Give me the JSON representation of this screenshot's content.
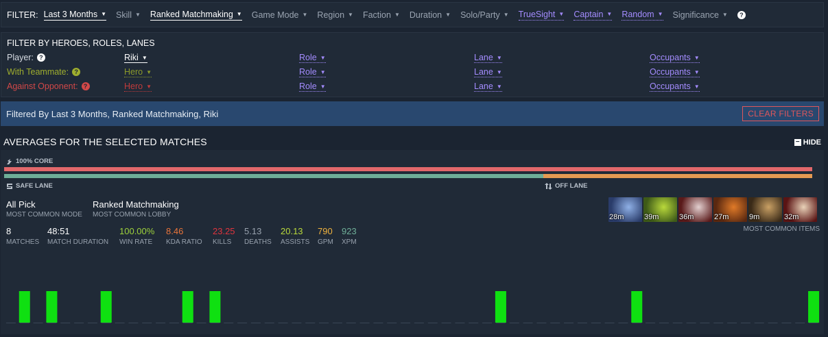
{
  "filterbar": {
    "label": "FILTER:",
    "items": [
      {
        "label": "Last 3 Months",
        "style": "sel"
      },
      {
        "label": "Skill",
        "style": "dim"
      },
      {
        "label": "Ranked Matchmaking",
        "style": "sel"
      },
      {
        "label": "Game Mode",
        "style": "dim"
      },
      {
        "label": "Region",
        "style": "dim"
      },
      {
        "label": "Faction",
        "style": "dim"
      },
      {
        "label": "Duration",
        "style": "dim"
      },
      {
        "label": "Solo/Party",
        "style": "dim"
      },
      {
        "label": "TrueSight",
        "style": "purple"
      },
      {
        "label": "Captain",
        "style": "purple"
      },
      {
        "label": "Random",
        "style": "purple"
      },
      {
        "label": "Significance",
        "style": "dim"
      }
    ],
    "help_icon": "?"
  },
  "heroes": {
    "title": "FILTER BY HEROES, ROLES, LANES",
    "rows": [
      {
        "label": "Player:",
        "color": "#d6dbe2",
        "help": "?",
        "hero": "Riki",
        "role": "Role",
        "lane": "Lane",
        "occupants": "Occupants"
      },
      {
        "label": "With Teammate:",
        "color": "#9fae2e",
        "help": "?",
        "hero": "Hero",
        "role": "Role",
        "lane": "Lane",
        "occupants": "Occupants"
      },
      {
        "label": "Against Opponent:",
        "color": "#d24848",
        "help": "?",
        "hero": "Hero",
        "role": "Role",
        "lane": "Lane",
        "occupants": "Occupants"
      }
    ]
  },
  "filtered_by": {
    "text": "Filtered By Last 3 Months, Ranked Matchmaking, Riki",
    "clear_label": "CLEAR FILTERS"
  },
  "averages": {
    "title": "AVERAGES FOR THE SELECTED MATCHES",
    "hide_label": "HIDE",
    "core_label": "100% CORE",
    "core_fraction": 1.0,
    "safe_lane_fraction": 0.667,
    "safe_lane_label": "SAFE LANE",
    "off_lane_label": "OFF LANE",
    "mode": {
      "value": "All Pick",
      "label": "MOST COMMON MODE"
    },
    "lobby": {
      "value": "Ranked Matchmaking",
      "label": "MOST COMMON LOBBY"
    },
    "stats": [
      {
        "value": "8",
        "label": "MATCHES",
        "color": "#ffffff"
      },
      {
        "value": "48:51",
        "label": "MATCH DURATION",
        "color": "#ffffff"
      },
      {
        "value": "100.00%",
        "label": "WIN RATE",
        "color": "#9ed23b"
      },
      {
        "value": "8.46",
        "label": "KDA RATIO",
        "color": "#e8743a"
      },
      {
        "value": "23.25",
        "label": "KILLS",
        "color": "#e0343d"
      },
      {
        "value": "5.13",
        "label": "DEATHS",
        "color": "#98a2ae"
      },
      {
        "value": "20.13",
        "label": "ASSISTS",
        "color": "#b9d93b"
      },
      {
        "value": "790",
        "label": "GPM",
        "color": "#f0b33e"
      },
      {
        "value": "923",
        "label": "XPM",
        "color": "#6fae98"
      }
    ],
    "items": [
      {
        "time": "28m",
        "icon": "item-1-icon",
        "c1": "#2a3c6a",
        "c2": "#8fb0e6"
      },
      {
        "time": "39m",
        "icon": "item-2-icon",
        "c1": "#3e5a18",
        "c2": "#b9d93b"
      },
      {
        "time": "36m",
        "icon": "item-3-icon",
        "c1": "#5a1a1a",
        "c2": "#e2cfcf"
      },
      {
        "time": "27m",
        "icon": "item-4-icon",
        "c1": "#5a2810",
        "c2": "#e07a28"
      },
      {
        "time": "9m",
        "icon": "item-5-icon",
        "c1": "#3a2a18",
        "c2": "#c9a064"
      },
      {
        "time": "32m",
        "icon": "item-6-icon",
        "c1": "#5a1414",
        "c2": "#e9d2b8"
      }
    ],
    "items_label": "MOST COMMON ITEMS"
  },
  "chart_data": {
    "type": "bar",
    "description_color": "#0fe011",
    "slots": 60,
    "values": [
      0,
      1,
      0,
      1,
      0,
      0,
      0,
      1,
      0,
      0,
      0,
      0,
      0,
      1,
      0,
      1,
      0,
      0,
      0,
      0,
      0,
      0,
      0,
      0,
      0,
      0,
      0,
      0,
      0,
      0,
      0,
      0,
      0,
      0,
      0,
      0,
      1,
      0,
      0,
      0,
      0,
      0,
      0,
      0,
      0,
      0,
      1,
      0,
      0,
      0,
      0,
      0,
      0,
      0,
      0,
      0,
      0,
      0,
      0,
      1
    ]
  }
}
